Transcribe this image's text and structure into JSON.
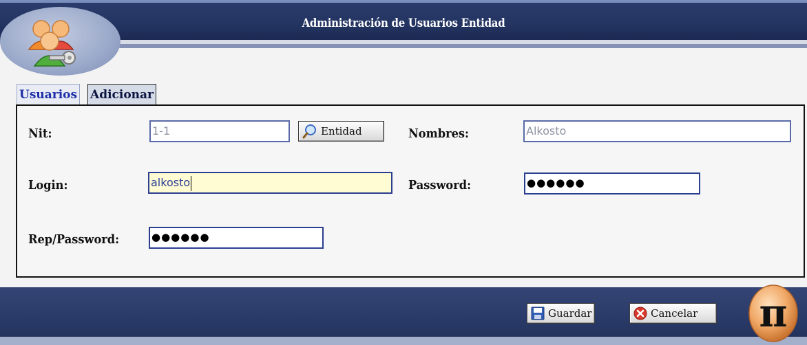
{
  "header": {
    "title": "Administración de Usuarios Entidad"
  },
  "tabs": [
    {
      "label": "Usuarios"
    },
    {
      "label": "Adicionar"
    }
  ],
  "form": {
    "nit": {
      "label": "Nit:",
      "value": "1-1"
    },
    "entidad_button": {
      "label": "Entidad",
      "icon": "magnifier-icon"
    },
    "nombres": {
      "label": "Nombres:",
      "value": "Alkosto"
    },
    "login": {
      "label": "Login:",
      "value": "alkosto"
    },
    "password": {
      "label": "Password:",
      "value": "●●●●●●"
    },
    "rep_password": {
      "label": "Rep/Password:",
      "value": "●●●●●●"
    }
  },
  "footer": {
    "guardar_button": {
      "label": "Guardar",
      "icon": "floppy-disk-icon"
    },
    "cancelar_button": {
      "label": "Cancelar",
      "icon": "red-x-circle-icon"
    },
    "logo": {
      "icon": "pi-icon"
    }
  },
  "colors": {
    "header": "#233461",
    "tab_active_text": "#1c2fa8",
    "field_border": "#2b3e8f",
    "focus_bg": "#fffbd2"
  }
}
